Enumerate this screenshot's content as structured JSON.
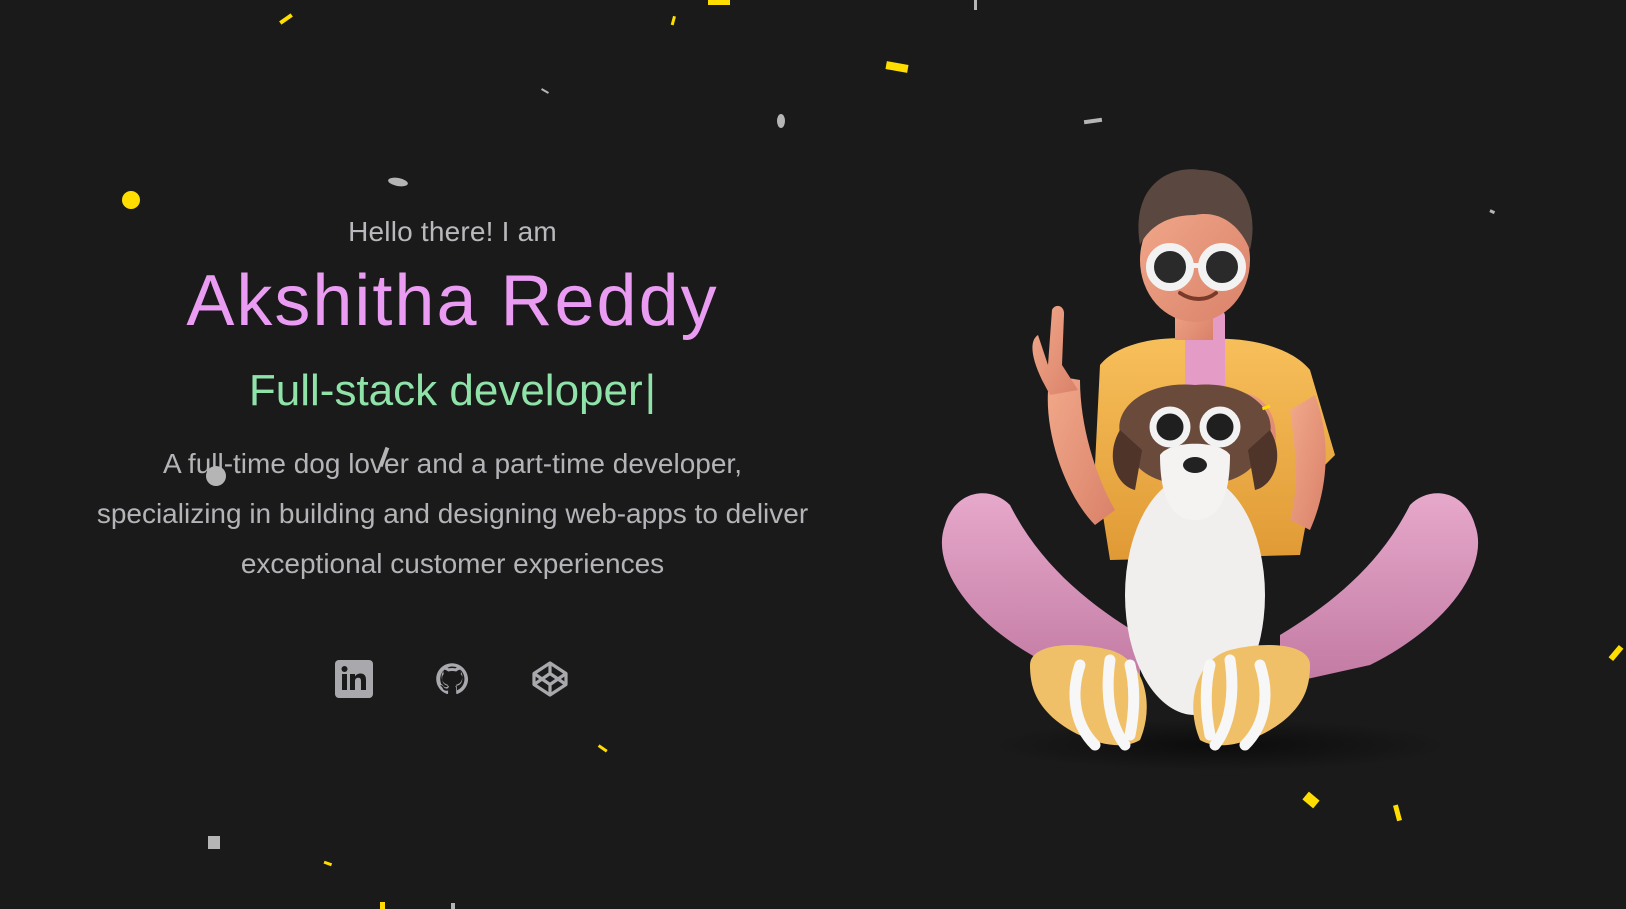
{
  "hero": {
    "greeting": "Hello there! I am",
    "name": "Akshitha Reddy",
    "role": "Full-stack developer",
    "caret": "|",
    "description_lines": [
      "A full-time dog lover and a part-time developer,",
      "specializing in building and designing web-apps to deliver",
      "exceptional customer experiences"
    ]
  },
  "socials": [
    {
      "icon": "linkedin-icon"
    },
    {
      "icon": "github-icon"
    },
    {
      "icon": "codepen-icon"
    }
  ],
  "colors": {
    "background": "#1a1a1b",
    "name": "#ea9cf2",
    "role": "#8fe3a8",
    "text": "#b4b4b8",
    "icons": "#a9a9ad",
    "confetti_yellow": "#ffdd00",
    "confetti_gray": "#b5b5b5"
  },
  "illustration": {
    "icon": "avatar-with-dog-illustration"
  }
}
